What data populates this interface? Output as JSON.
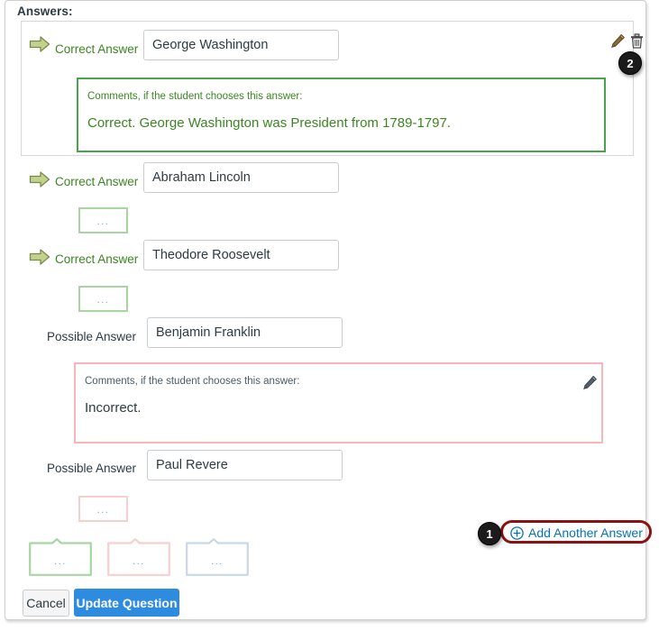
{
  "page": {
    "heading": "Answers:",
    "accent_blue": "#0374b5",
    "correct_green": "#3b8622",
    "highlight_red": "#8c1111",
    "button_blue": "#2d8ce0"
  },
  "answers": [
    {
      "label": "Correct Answer",
      "kind": "correct",
      "value": "George Washington",
      "comment": {
        "caption": "Comments, if the student chooses this answer:",
        "body": "Correct. George Washington was President from 1789-1797.",
        "state": "expanded",
        "tone": "green"
      },
      "icons": {
        "edit": "pencil-icon",
        "delete": "trash-icon"
      }
    },
    {
      "label": "Correct Answer",
      "kind": "correct",
      "value": "Abraham Lincoln",
      "comment": {
        "stub_text": "...",
        "state": "collapsed",
        "tone": "green"
      }
    },
    {
      "label": "Correct Answer",
      "kind": "correct",
      "value": "Theodore Roosevelt",
      "comment": {
        "stub_text": "...",
        "state": "collapsed",
        "tone": "green"
      }
    },
    {
      "label": "Possible Answer",
      "kind": "possible",
      "value": "Benjamin Franklin",
      "comment": {
        "caption": "Comments, if the student chooses this answer:",
        "body": "Incorrect.",
        "state": "expanded",
        "tone": "pink"
      },
      "icons": {
        "edit": "pencil-icon"
      }
    },
    {
      "label": "Possible Answer",
      "kind": "possible",
      "value": "Paul Revere",
      "comment": {
        "stub_text": "...",
        "state": "collapsed",
        "tone": "pink"
      }
    }
  ],
  "add_answer": {
    "label": "Add Another Answer",
    "icon": "plus-circle-icon"
  },
  "callouts": [
    {
      "tone": "green",
      "dots": "..."
    },
    {
      "tone": "pink",
      "dots": "..."
    },
    {
      "tone": "blue",
      "dots": "..."
    }
  ],
  "badges": [
    {
      "number": "1"
    },
    {
      "number": "2"
    }
  ],
  "footer": {
    "cancel_label": "Cancel",
    "update_label": "Update Question"
  }
}
